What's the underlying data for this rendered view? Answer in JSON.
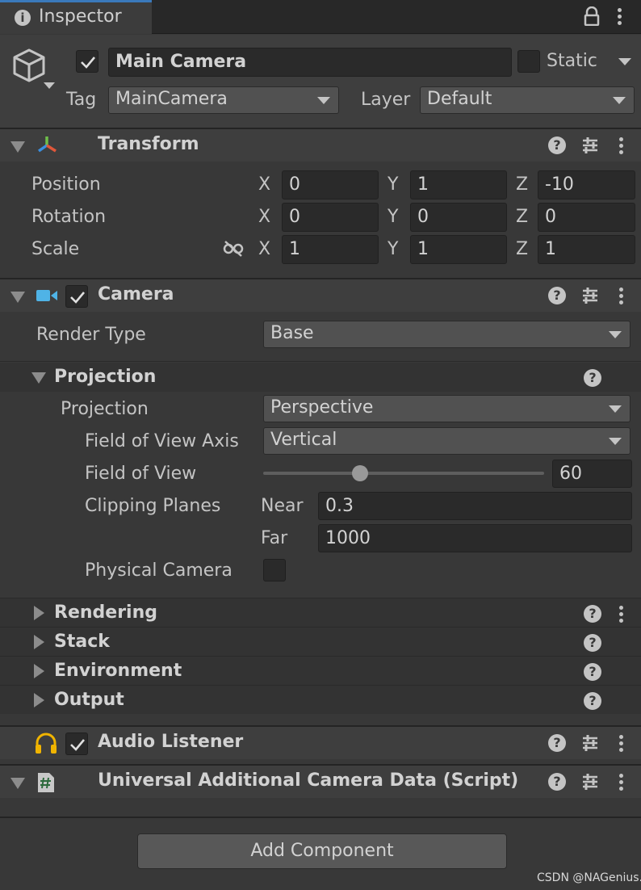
{
  "tab": {
    "title": "Inspector"
  },
  "object": {
    "name": "Main Camera",
    "enabled": true,
    "static_label": "Static",
    "tag_label": "Tag",
    "tag_value": "MainCamera",
    "layer_label": "Layer",
    "layer_value": "Default"
  },
  "transform": {
    "title": "Transform",
    "rows": [
      {
        "label": "Position",
        "x": "0",
        "y": "1",
        "z": "-10"
      },
      {
        "label": "Rotation",
        "x": "0",
        "y": "0",
        "z": "0"
      },
      {
        "label": "Scale",
        "x": "1",
        "y": "1",
        "z": "1"
      }
    ],
    "axes": {
      "x": "X",
      "y": "Y",
      "z": "Z"
    }
  },
  "camera": {
    "title": "Camera",
    "render_type_label": "Render Type",
    "render_type_value": "Base",
    "projection_header": "Projection",
    "projection_label": "Projection",
    "projection_value": "Perspective",
    "fov_axis_label": "Field of View Axis",
    "fov_axis_value": "Vertical",
    "fov_label": "Field of View",
    "fov_value": "60",
    "fov_slider_fraction": 0.345,
    "clipping_label": "Clipping Planes",
    "near_label": "Near",
    "near_value": "0.3",
    "far_label": "Far",
    "far_value": "1000",
    "physical_label": "Physical Camera",
    "sections": [
      "Rendering",
      "Stack",
      "Environment",
      "Output"
    ]
  },
  "audio_listener": {
    "title": "Audio Listener"
  },
  "script_component": {
    "title": "Universal Additional Camera Data (Script)"
  },
  "add_component": "Add Component",
  "watermark": "CSDN @NAGenius.",
  "colors": {
    "background": "#383838",
    "field": "#2a2a2a",
    "dropdown": "#515151",
    "tab_accent": "#3a79bb",
    "camera_icon": "#4fb3e6",
    "headphone_icon": "#f0b400",
    "script_icon": "#c8c8c8"
  }
}
